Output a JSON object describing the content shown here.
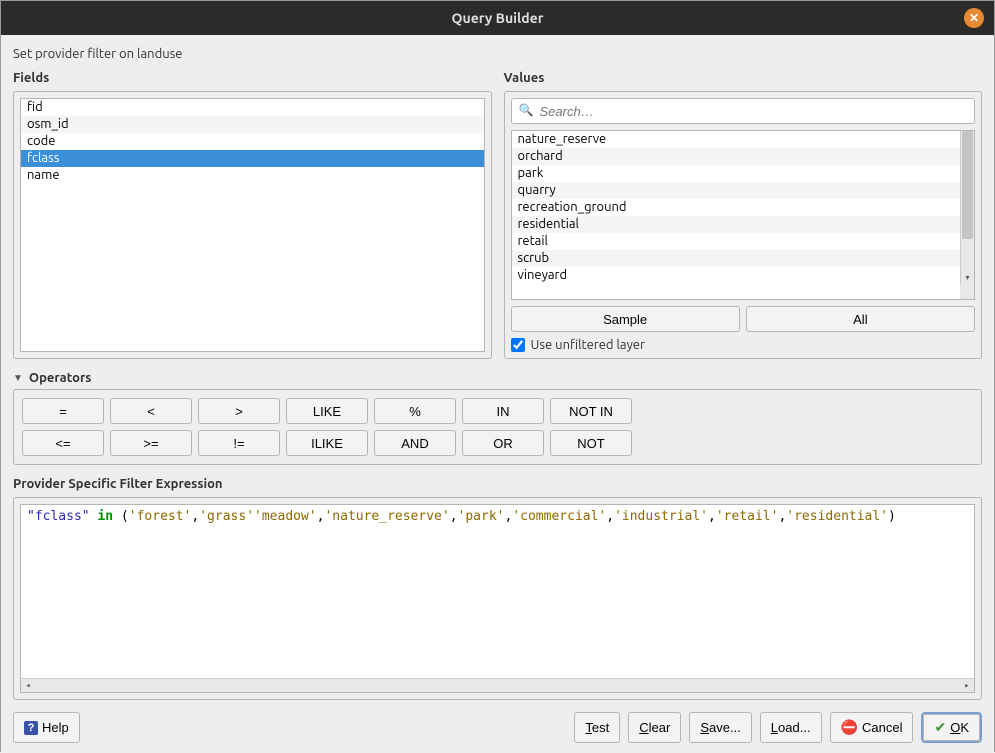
{
  "window": {
    "title": "Query Builder"
  },
  "subtitle": "Set provider filter on landuse",
  "fields": {
    "label": "Fields",
    "items": [
      "fid",
      "osm_id",
      "code",
      "fclass",
      "name"
    ],
    "selected_index": 3
  },
  "values": {
    "label": "Values",
    "search_placeholder": "Search…",
    "items": [
      "nature_reserve",
      "orchard",
      "park",
      "quarry",
      "recreation_ground",
      "residential",
      "retail",
      "scrub",
      "vineyard"
    ],
    "sample_btn": "Sample",
    "all_btn": "All",
    "use_unfiltered_label": "Use unfiltered layer",
    "use_unfiltered_checked": true
  },
  "operators": {
    "label": "Operators",
    "row1": [
      "=",
      "<",
      ">",
      "LIKE",
      "%",
      "IN",
      "NOT IN"
    ],
    "row2": [
      "<=",
      ">=",
      "!=",
      "ILIKE",
      "AND",
      "OR",
      "NOT"
    ]
  },
  "expression": {
    "label": "Provider Specific Filter Expression",
    "tokens": [
      {
        "cls": "tok-col",
        "t": "\"fclass\""
      },
      {
        "cls": "",
        "t": " "
      },
      {
        "cls": "tok-kw",
        "t": "in"
      },
      {
        "cls": "",
        "t": " ("
      },
      {
        "cls": "tok-str",
        "t": "'forest'"
      },
      {
        "cls": "",
        "t": ","
      },
      {
        "cls": "tok-str",
        "t": "'grass'"
      },
      {
        "cls": "tok-str",
        "t": "'meadow'"
      },
      {
        "cls": "",
        "t": ","
      },
      {
        "cls": "tok-str",
        "t": "'nature_reserve'"
      },
      {
        "cls": "",
        "t": ","
      },
      {
        "cls": "tok-str",
        "t": "'park'"
      },
      {
        "cls": "",
        "t": ","
      },
      {
        "cls": "tok-str",
        "t": "'commercial'"
      },
      {
        "cls": "",
        "t": ","
      },
      {
        "cls": "tok-str",
        "t": "'industrial'"
      },
      {
        "cls": "",
        "t": ","
      },
      {
        "cls": "tok-str",
        "t": "'retail'"
      },
      {
        "cls": "",
        "t": ","
      },
      {
        "cls": "tok-str",
        "t": "'residential'"
      },
      {
        "cls": "",
        "t": ")"
      }
    ]
  },
  "footer": {
    "help": "Help",
    "test": "Test",
    "clear": "Clear",
    "save": "Save...",
    "load": "Load...",
    "cancel": "Cancel",
    "ok": "OK"
  }
}
